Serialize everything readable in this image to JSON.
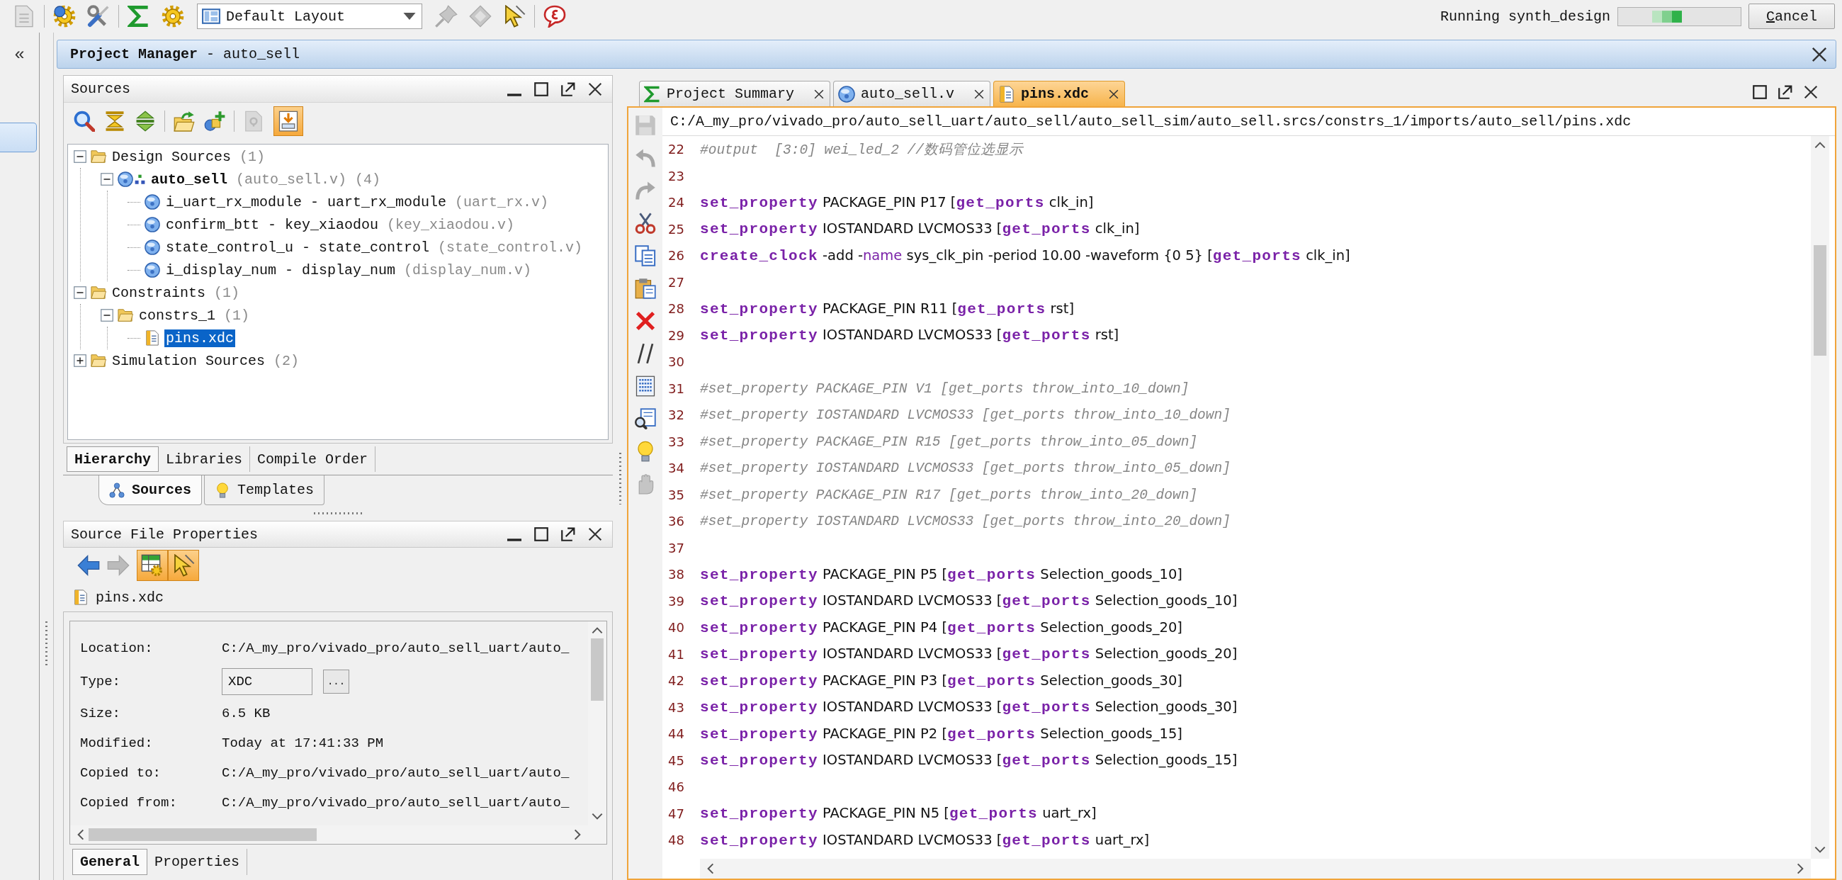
{
  "toolbar": {
    "left_groups": [
      {
        "tools": [
          {
            "kind": "document",
            "disabled": true
          }
        ]
      },
      {
        "tools": [
          {
            "kind": "run-gear",
            "disabled": false
          },
          {
            "kind": "tools",
            "disabled": false
          }
        ]
      },
      {
        "tools": [
          {
            "kind": "sigma",
            "disabled": false
          },
          {
            "kind": "gear",
            "disabled": false
          }
        ]
      }
    ],
    "layout_select": {
      "value": "Default Layout"
    },
    "right_groups": [
      {
        "tools": [
          {
            "kind": "pin",
            "disabled": true
          },
          {
            "kind": "chip",
            "disabled": true
          },
          {
            "kind": "cursor",
            "disabled": false
          }
        ]
      },
      {
        "tools": [
          {
            "kind": "feedback",
            "disabled": false
          }
        ]
      }
    ],
    "status": "Running synth_design",
    "cancel": "Cancel"
  },
  "flow_navigator": {
    "toggle": "«",
    "items": [
      {
        "selected": true
      }
    ]
  },
  "project_manager": {
    "title": "**Project Manager** - auto_sell"
  },
  "sources": {
    "title": "Sources",
    "tool_groups": [
      {
        "tools": [
          {
            "kind": "search",
            "pressed": false,
            "disabled": false
          },
          {
            "kind": "collapse-all",
            "pressed": false,
            "disabled": false
          },
          {
            "kind": "expand-all",
            "pressed": false,
            "disabled": false
          }
        ]
      },
      {
        "tools": [
          {
            "kind": "add-folder",
            "pressed": false,
            "disabled": false
          },
          {
            "kind": "add-sources",
            "pressed": false,
            "disabled": false
          }
        ]
      },
      {
        "tools": [
          {
            "kind": "help",
            "pressed": false,
            "disabled": true
          },
          {
            "kind": "doc-arrow",
            "pressed": true,
            "disabled": false
          }
        ]
      }
    ],
    "tree": [
      {
        "kind": "folder",
        "label": "Design Sources",
        "note": "(1)",
        "expanded": true,
        "selected": false,
        "children": [
          {
            "kind": "verilog",
            "top": true,
            "label": "auto_sell",
            "note": "(auto_sell.v) (4)",
            "expanded": true,
            "selected": false,
            "children": [
              {
                "kind": "verilog",
                "label": "i_uart_rx_module - uart_rx_module",
                "note": "(uart_rx.v)",
                "selected": false
              },
              {
                "kind": "verilog",
                "label": "confirm_btt - key_xiaodou",
                "note": "(key_xiaodou.v)",
                "selected": false
              },
              {
                "kind": "verilog",
                "label": "state_control_u - state_control",
                "note": "(state_control.v)",
                "selected": false
              },
              {
                "kind": "verilog",
                "label": "i_display_num - display_num",
                "note": "(display_num.v)",
                "selected": false
              }
            ]
          }
        ]
      },
      {
        "kind": "folder",
        "label": "Constraints",
        "note": "(1)",
        "expanded": true,
        "selected": false,
        "children": [
          {
            "kind": "folder",
            "label": "constrs_1",
            "note": "(1)",
            "expanded": true,
            "selected": false,
            "children": [
              {
                "kind": "xdc",
                "label": "pins.xdc",
                "selected": true
              }
            ]
          }
        ]
      },
      {
        "kind": "folder",
        "label": "Simulation Sources",
        "note": "(2)",
        "expanded": false,
        "selected": false
      }
    ],
    "tabs": [
      {
        "label": "Hierarchy",
        "selected": true
      },
      {
        "label": "Libraries",
        "selected": false
      },
      {
        "label": "Compile Order",
        "selected": false
      }
    ],
    "view_tabs": [
      {
        "kind": "hierarchy",
        "label": "Sources",
        "selected": true
      },
      {
        "kind": "bulb",
        "label": "Templates",
        "selected": false
      }
    ]
  },
  "properties": {
    "title": "Source File Properties",
    "tools": [
      {
        "kind": "back",
        "pressed": false,
        "disabled": false
      },
      {
        "kind": "forward",
        "pressed": false,
        "disabled": true
      },
      {
        "kind": "table-gear",
        "pressed": true,
        "disabled": false
      },
      {
        "kind": "cursor",
        "pressed": true,
        "disabled": false
      }
    ],
    "file": {
      "kind": "xdc",
      "name": "pins.xdc"
    },
    "rows": [
      {
        "kind": "text",
        "label": "Location:",
        "value": "C:/A_my_pro/vivado_pro/auto_sell_uart/auto_"
      },
      {
        "kind": "field",
        "label": "Type:",
        "value": "XDC",
        "button": "..."
      },
      {
        "kind": "text",
        "label": "Size:",
        "value": "6.5 KB"
      },
      {
        "kind": "text",
        "label": "Modified:",
        "value": "Today at 17:41:33 PM"
      },
      {
        "kind": "text",
        "label": "Copied to:",
        "value": "C:/A_my_pro/vivado_pro/auto_sell_uart/auto_"
      },
      {
        "kind": "text",
        "label": "Copied from:",
        "value": "C:/A_my_pro/vivado_pro/auto_sell_uart/auto_"
      }
    ],
    "tabs": [
      {
        "label": "General",
        "selected": true
      },
      {
        "label": "Properties",
        "selected": false
      }
    ]
  },
  "editor": {
    "tabs": [
      {
        "kind": "summary",
        "label": "Project Summary",
        "selected": false
      },
      {
        "kind": "verilog",
        "label": "auto_sell.v",
        "selected": false
      },
      {
        "kind": "xdc",
        "label": "pins.xdc",
        "selected": true
      }
    ],
    "path": "C:/A_my_pro/vivado_pro/auto_sell_uart/auto_sell/auto_sell_sim/auto_sell.srcs/constrs_1/imports/auto_sell/pins.xdc",
    "tools": [
      {
        "kind": "save",
        "disabled": true
      },
      {
        "kind": "undo",
        "disabled": true
      },
      {
        "kind": "redo",
        "disabled": true
      },
      {
        "kind": "cut",
        "disabled": false
      },
      {
        "kind": "copy",
        "disabled": false
      },
      {
        "kind": "paste",
        "disabled": false
      },
      {
        "kind": "delete",
        "disabled": false
      },
      {
        "kind": "comment",
        "disabled": false
      },
      {
        "kind": "block",
        "disabled": false
      },
      {
        "kind": "find",
        "disabled": false
      },
      {
        "kind": "bulb",
        "disabled": false
      },
      {
        "kind": "hand",
        "disabled": true
      }
    ],
    "lines": [
      {
        "number": "22",
        "segments": [
          {
            "kind": "comment",
            "text": "#output  [3:0] wei_led_2 //数码管位选显示"
          }
        ]
      },
      {
        "number": "23"
      },
      {
        "number": "24",
        "segments": [
          {
            "kind": "keyword",
            "text": "set_property"
          },
          {
            "kind": "plain",
            "text": " PACKAGE_PIN P17 ["
          },
          {
            "kind": "keyword",
            "text": "get_ports"
          },
          {
            "kind": "plain",
            "text": " clk_in]"
          }
        ]
      },
      {
        "number": "25",
        "segments": [
          {
            "kind": "keyword",
            "text": "set_property"
          },
          {
            "kind": "plain",
            "text": " IOSTANDARD LVCMOS33 ["
          },
          {
            "kind": "keyword",
            "text": "get_ports"
          },
          {
            "kind": "plain",
            "text": " clk_in]"
          }
        ]
      },
      {
        "number": "26",
        "segments": [
          {
            "kind": "keyword",
            "text": "create_clock"
          },
          {
            "kind": "plain",
            "text": " -add -"
          },
          {
            "kind": "option",
            "text": "name"
          },
          {
            "kind": "plain",
            "text": " sys_clk_pin -period 10.00 -waveform {0 5} ["
          },
          {
            "kind": "keyword",
            "text": "get_ports"
          },
          {
            "kind": "plain",
            "text": " clk_in]"
          }
        ]
      },
      {
        "number": "27"
      },
      {
        "number": "28",
        "segments": [
          {
            "kind": "keyword",
            "text": "set_property"
          },
          {
            "kind": "plain",
            "text": " PACKAGE_PIN R11 ["
          },
          {
            "kind": "keyword",
            "text": "get_ports"
          },
          {
            "kind": "plain",
            "text": " rst]"
          }
        ]
      },
      {
        "number": "29",
        "segments": [
          {
            "kind": "keyword",
            "text": "set_property"
          },
          {
            "kind": "plain",
            "text": " IOSTANDARD LVCMOS33 ["
          },
          {
            "kind": "keyword",
            "text": "get_ports"
          },
          {
            "kind": "plain",
            "text": " rst]"
          }
        ]
      },
      {
        "number": "30"
      },
      {
        "number": "31",
        "segments": [
          {
            "kind": "comment",
            "text": "#set_property PACKAGE_PIN V1 [get_ports throw_into_10_down]"
          }
        ]
      },
      {
        "number": "32",
        "segments": [
          {
            "kind": "comment",
            "text": "#set_property IOSTANDARD LVCMOS33 [get_ports throw_into_10_down]"
          }
        ]
      },
      {
        "number": "33",
        "segments": [
          {
            "kind": "comment",
            "text": "#set_property PACKAGE_PIN R15 [get_ports throw_into_05_down]"
          }
        ]
      },
      {
        "number": "34",
        "segments": [
          {
            "kind": "comment",
            "text": "#set_property IOSTANDARD LVCMOS33 [get_ports throw_into_05_down]"
          }
        ]
      },
      {
        "number": "35",
        "segments": [
          {
            "kind": "comment",
            "text": "#set_property PACKAGE_PIN R17 [get_ports throw_into_20_down]"
          }
        ]
      },
      {
        "number": "36",
        "segments": [
          {
            "kind": "comment",
            "text": "#set_property IOSTANDARD LVCMOS33 [get_ports throw_into_20_down]"
          }
        ]
      },
      {
        "number": "37"
      },
      {
        "number": "38",
        "segments": [
          {
            "kind": "keyword",
            "text": "set_property"
          },
          {
            "kind": "plain",
            "text": " PACKAGE_PIN P5 ["
          },
          {
            "kind": "keyword",
            "text": "get_ports"
          },
          {
            "kind": "plain",
            "text": " Selection_goods_10]"
          }
        ]
      },
      {
        "number": "39",
        "segments": [
          {
            "kind": "keyword",
            "text": "set_property"
          },
          {
            "kind": "plain",
            "text": " IOSTANDARD LVCMOS33 ["
          },
          {
            "kind": "keyword",
            "text": "get_ports"
          },
          {
            "kind": "plain",
            "text": " Selection_goods_10]"
          }
        ]
      },
      {
        "number": "40",
        "segments": [
          {
            "kind": "keyword",
            "text": "set_property"
          },
          {
            "kind": "plain",
            "text": " PACKAGE_PIN P4 ["
          },
          {
            "kind": "keyword",
            "text": "get_ports"
          },
          {
            "kind": "plain",
            "text": " Selection_goods_20]"
          }
        ]
      },
      {
        "number": "41",
        "segments": [
          {
            "kind": "keyword",
            "text": "set_property"
          },
          {
            "kind": "plain",
            "text": " IOSTANDARD LVCMOS33 ["
          },
          {
            "kind": "keyword",
            "text": "get_ports"
          },
          {
            "kind": "plain",
            "text": " Selection_goods_20]"
          }
        ]
      },
      {
        "number": "42",
        "segments": [
          {
            "kind": "keyword",
            "text": "set_property"
          },
          {
            "kind": "plain",
            "text": " PACKAGE_PIN P3 ["
          },
          {
            "kind": "keyword",
            "text": "get_ports"
          },
          {
            "kind": "plain",
            "text": " Selection_goods_30]"
          }
        ]
      },
      {
        "number": "43",
        "segments": [
          {
            "kind": "keyword",
            "text": "set_property"
          },
          {
            "kind": "plain",
            "text": " IOSTANDARD LVCMOS33 ["
          },
          {
            "kind": "keyword",
            "text": "get_ports"
          },
          {
            "kind": "plain",
            "text": " Selection_goods_30]"
          }
        ]
      },
      {
        "number": "44",
        "segments": [
          {
            "kind": "keyword",
            "text": "set_property"
          },
          {
            "kind": "plain",
            "text": " PACKAGE_PIN P2 ["
          },
          {
            "kind": "keyword",
            "text": "get_ports"
          },
          {
            "kind": "plain",
            "text": " Selection_goods_15]"
          }
        ]
      },
      {
        "number": "45",
        "segments": [
          {
            "kind": "keyword",
            "text": "set_property"
          },
          {
            "kind": "plain",
            "text": " IOSTANDARD LVCMOS33 ["
          },
          {
            "kind": "keyword",
            "text": "get_ports"
          },
          {
            "kind": "plain",
            "text": " Selection_goods_15]"
          }
        ]
      },
      {
        "number": "46"
      },
      {
        "number": "47",
        "segments": [
          {
            "kind": "keyword",
            "text": "set_property"
          },
          {
            "kind": "plain",
            "text": " PACKAGE_PIN N5 ["
          },
          {
            "kind": "keyword",
            "text": "get_ports"
          },
          {
            "kind": "plain",
            "text": " uart_rx]"
          }
        ]
      },
      {
        "number": "48",
        "segments": [
          {
            "kind": "keyword",
            "text": "set_property"
          },
          {
            "kind": "plain",
            "text": " IOSTANDARD LVCMOS33 ["
          },
          {
            "kind": "keyword",
            "text": "get_ports"
          },
          {
            "kind": "plain",
            "text": " uart_rx]"
          }
        ]
      }
    ]
  }
}
